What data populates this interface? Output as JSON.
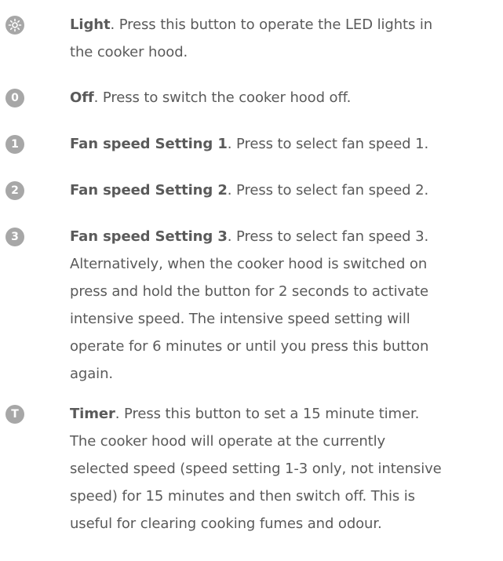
{
  "colors": {
    "text": "#5a5a5a",
    "icon_bg": "#a7a7a7",
    "icon_fg": "#ffffff"
  },
  "items": [
    {
      "icon": "light-icon",
      "term": "Light",
      "lines": [
        ". Press this button to operate the LED lights in",
        "the cooker hood."
      ]
    },
    {
      "icon": "off-icon",
      "icon_text": "0",
      "term": "Off",
      "lines": [
        ". Press to switch the cooker hood off."
      ]
    },
    {
      "icon": "speed-1-icon",
      "icon_text": "1",
      "term": "Fan speed Setting 1",
      "lines": [
        ". Press to select fan speed 1."
      ]
    },
    {
      "icon": "speed-2-icon",
      "icon_text": "2",
      "term": "Fan speed Setting 2",
      "lines": [
        ". Press to select fan speed 2."
      ]
    },
    {
      "icon": "speed-3-icon",
      "icon_text": "3",
      "term": "Fan speed Setting 3",
      "lines": [
        ". Press to select fan speed 3.",
        "Alternatively, when the cooker hood is switched on",
        "press and hold the button for 2 seconds to activate",
        "intensive speed. The intensive speed setting will",
        "operate for 6 minutes or until you press this button",
        "again."
      ]
    },
    {
      "icon": "timer-icon",
      "icon_text": "T",
      "term": "Timer",
      "lines": [
        ". Press this button to set a 15 minute timer.",
        "The cooker hood will operate at the currently",
        "selected speed (speed setting 1-3 only, not intensive",
        "speed) for 15 minutes and then switch off. This is",
        "useful for clearing cooking fumes and odour."
      ]
    }
  ]
}
